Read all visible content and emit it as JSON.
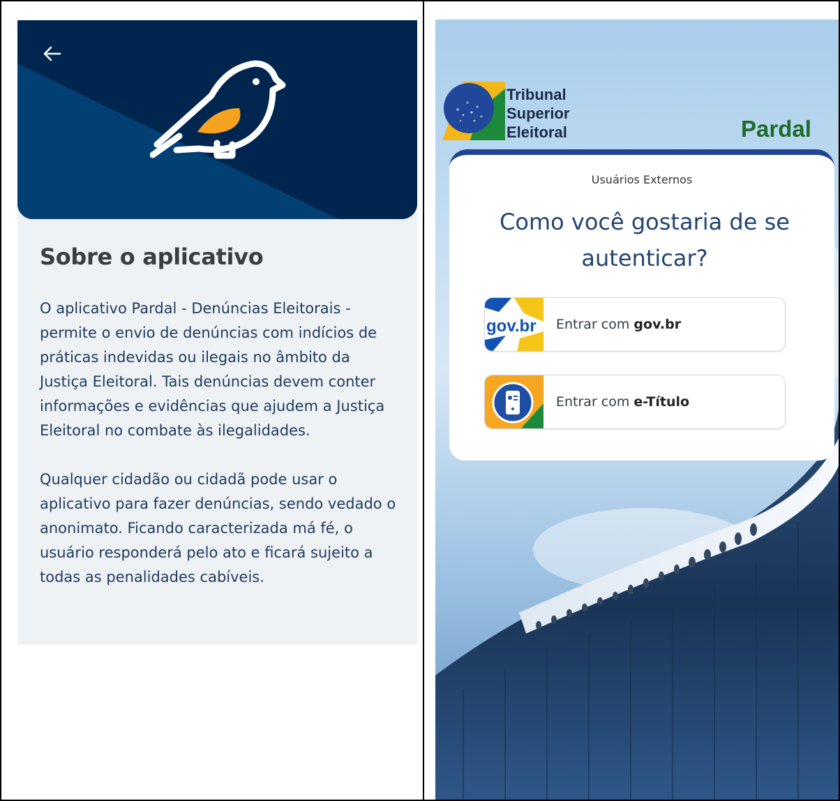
{
  "left_screen": {
    "back_icon": "arrow-left-icon",
    "bird_logo": "pardal-bird-icon",
    "title": "Sobre o aplicativo",
    "paragraph_1": "O aplicativo Pardal - Denúncias Eleitorais - permite o envio de denúncias com indícios de práticas indevidas ou ilegais no âmbito da Justiça Eleitoral. Tais denúncias devem conter informações e evidências que ajudem a Justiça Eleitoral no combate às ilegalidades.",
    "paragraph_2": "Qualquer cidadão ou cidadã pode usar o aplicativo para fazer denúncias, sendo vedado o anonimato. Ficando caracterizada má fé, o usuário responderá pelo ato e ficará sujeito a todas as penalidades cabíveis.",
    "colors": {
      "hero_dark": "#002a55",
      "hero_light": "#023f73",
      "text": "#1f3a5c",
      "bird_accent": "#f4a21f"
    }
  },
  "right_screen": {
    "org_line_1": "Tribunal",
    "org_line_2": "Superior",
    "org_line_3": "Eleitoral",
    "app_name": "Pardal",
    "subtitle": "Usuários Externos",
    "heading": "Como você gostaria de se autenticar?",
    "login_options": [
      {
        "icon": "govbr-logo-icon",
        "label_prefix": "Entrar com ",
        "label_bold": "gov.br",
        "logo_text": "gov.br"
      },
      {
        "icon": "etitulo-app-icon",
        "label_prefix": "Entrar com ",
        "label_bold": "e-Título"
      }
    ],
    "colors": {
      "app_name": "#1e6b2d",
      "card_border": "#20448f",
      "heading": "#23446f"
    }
  }
}
